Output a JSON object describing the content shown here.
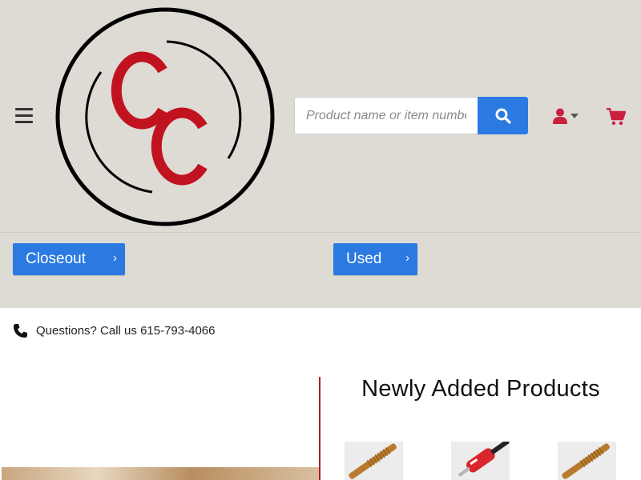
{
  "header": {
    "logo_text": "CC",
    "search": {
      "placeholder": "Product name or item number"
    }
  },
  "icons": {
    "menu": "hamburger-menu-icon",
    "search": "search-icon",
    "account": "user-icon",
    "account_dropdown": "caret-down-icon",
    "cart": "shopping-cart-icon",
    "phone": "phone-icon"
  },
  "categories": [
    {
      "label": "Closeout",
      "chevron": "›"
    },
    {
      "label": "Used",
      "chevron": "›"
    }
  ],
  "contact": {
    "text": "Questions? Call us 615-793-4066"
  },
  "newly_added": {
    "title": "Newly Added Products",
    "products": [
      {
        "name": "bronze-bore-brush"
      },
      {
        "name": "red-cleaning-rod-handle"
      },
      {
        "name": "bronze-bore-brush"
      }
    ]
  },
  "colors": {
    "header_bg": "#dedad4",
    "accent_blue": "#2a7ae2",
    "brand_red": "#c1121f",
    "icon_red": "#c8203f",
    "divider_red": "#b01c1c"
  }
}
